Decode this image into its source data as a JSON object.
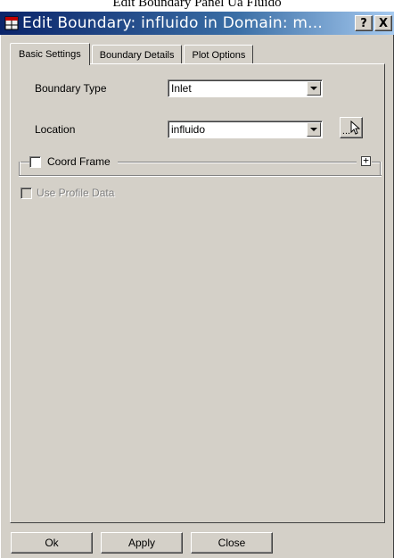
{
  "caption": "Edit Boundary Panel Ua Fluido",
  "window": {
    "title": "Edit Boundary: influido in Domain: m...",
    "help_button": "?",
    "close_button": "X"
  },
  "tabs": [
    {
      "label": "Basic Settings",
      "active": true
    },
    {
      "label": "Boundary Details",
      "active": false
    },
    {
      "label": "Plot Options",
      "active": false
    }
  ],
  "basic_settings": {
    "boundary_type": {
      "label": "Boundary Type",
      "value": "Inlet"
    },
    "location": {
      "label": "Location",
      "value": "influido",
      "picker_label": "..."
    },
    "coord_frame": {
      "label": "Coord Frame",
      "checked": false,
      "expander": "+"
    },
    "use_profile_data": {
      "label": "Use Profile Data",
      "checked": false,
      "enabled": false
    }
  },
  "buttons": {
    "ok": "Ok",
    "apply": "Apply",
    "close": "Close"
  }
}
